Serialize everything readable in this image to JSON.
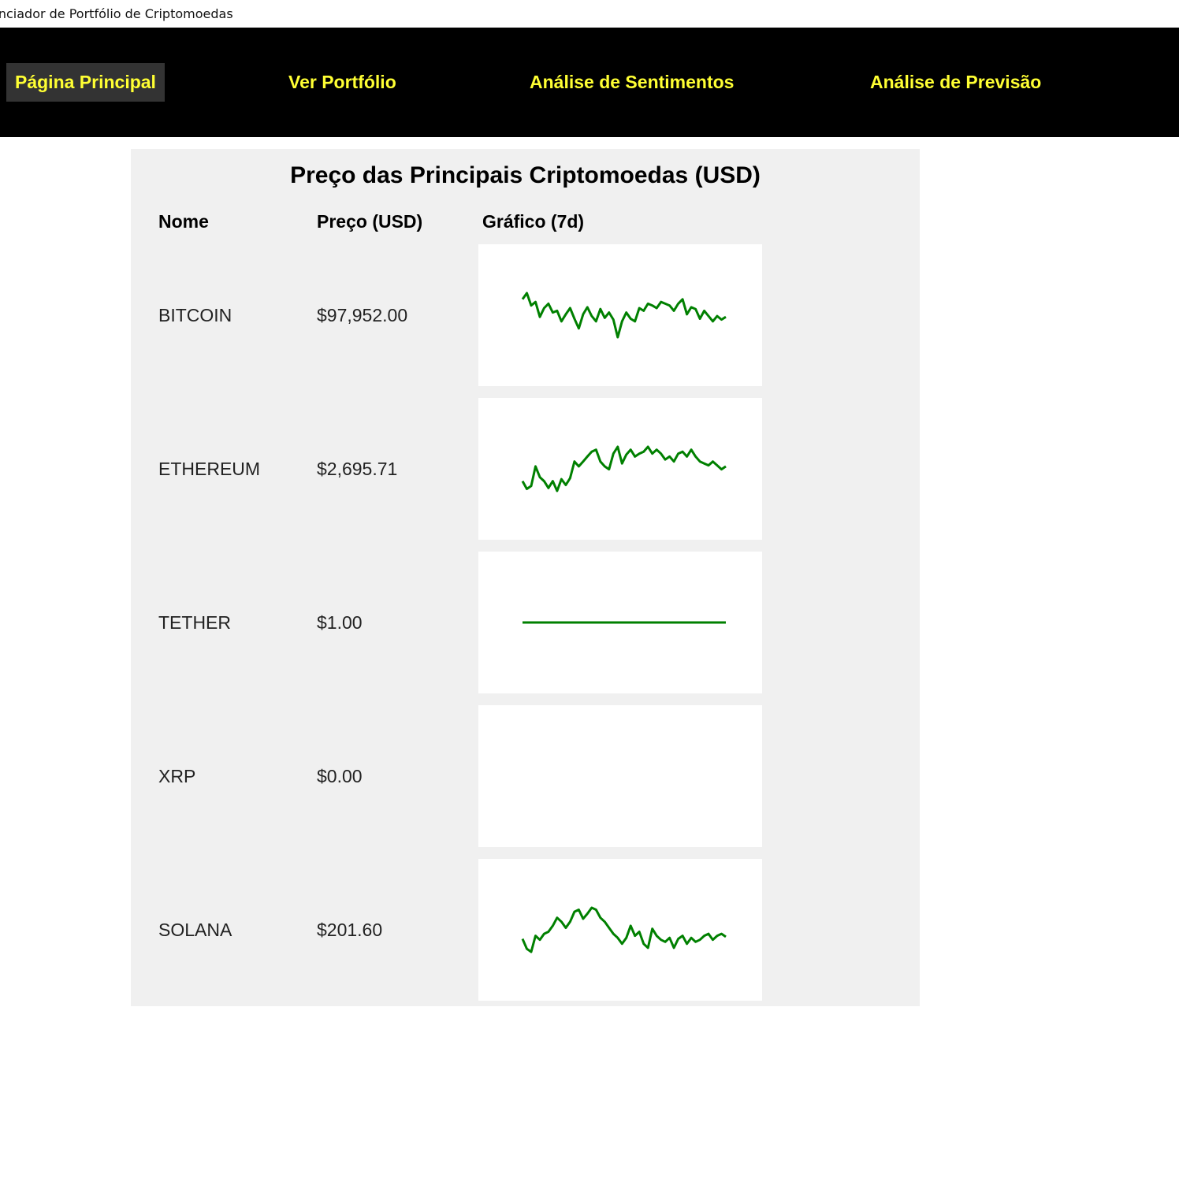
{
  "window": {
    "title": "enciador de Portfólio de Criptomoedas"
  },
  "nav": {
    "items": [
      {
        "label": "Página Principal",
        "active": true
      },
      {
        "label": "Ver Portfólio",
        "active": false
      },
      {
        "label": "Análise de Sentimentos",
        "active": false
      },
      {
        "label": "Análise de Previsão",
        "active": false
      }
    ]
  },
  "table": {
    "title": "Preço das Principais Criptomoedas (USD)",
    "headers": {
      "name": "Nome",
      "price": "Preço (USD)",
      "chart": "Gráfico (7d)"
    },
    "rows": [
      {
        "name": "BITCOIN",
        "price": "$97,952.00"
      },
      {
        "name": "ETHEREUM",
        "price": "$2,695.71"
      },
      {
        "name": "TETHER",
        "price": "$1.00"
      },
      {
        "name": "XRP",
        "price": "$0.00"
      },
      {
        "name": "SOLANA",
        "price": "$201.60"
      }
    ]
  },
  "colors": {
    "navbar_bg": "#000000",
    "nav_text": "#ffff33",
    "nav_active_bg": "#333333",
    "panel_bg": "#f0f0f0",
    "sparkline": "#008000"
  },
  "chart_data": [
    {
      "type": "line",
      "series": [
        {
          "values": [
            0.55,
            0.62,
            0.48,
            0.52,
            0.35,
            0.45,
            0.5,
            0.4,
            0.42,
            0.3,
            0.38,
            0.45,
            0.33,
            0.22,
            0.38,
            0.46,
            0.36,
            0.3,
            0.44,
            0.34,
            0.4,
            0.32,
            0.12,
            0.3,
            0.4,
            0.33,
            0.3,
            0.45,
            0.42,
            0.5,
            0.48,
            0.45,
            0.52,
            0.5,
            0.48,
            0.42,
            0.5,
            0.55,
            0.38,
            0.46,
            0.44,
            0.33,
            0.42,
            0.36,
            0.3,
            0.36,
            0.32,
            0.35
          ]
        }
      ]
    },
    {
      "type": "line",
      "series": [
        {
          "values": [
            0.3,
            0.22,
            0.25,
            0.45,
            0.34,
            0.3,
            0.23,
            0.3,
            0.2,
            0.32,
            0.26,
            0.33,
            0.5,
            0.45,
            0.5,
            0.55,
            0.6,
            0.62,
            0.5,
            0.45,
            0.42,
            0.58,
            0.65,
            0.48,
            0.57,
            0.62,
            0.55,
            0.58,
            0.6,
            0.65,
            0.58,
            0.62,
            0.58,
            0.52,
            0.55,
            0.5,
            0.58,
            0.6,
            0.55,
            0.62,
            0.55,
            0.5,
            0.48,
            0.46,
            0.5,
            0.46,
            0.42,
            0.45
          ]
        }
      ]
    },
    {
      "type": "line",
      "series": [
        {
          "values": [
            1.0,
            1.0,
            1.0,
            1.0,
            1.0,
            1.0,
            1.0,
            1.0
          ]
        }
      ]
    },
    {
      "type": "line",
      "series": [
        {
          "values": []
        }
      ]
    },
    {
      "type": "line",
      "series": [
        {
          "values": [
            0.45,
            0.35,
            0.32,
            0.48,
            0.44,
            0.5,
            0.52,
            0.58,
            0.66,
            0.62,
            0.56,
            0.62,
            0.72,
            0.74,
            0.65,
            0.7,
            0.76,
            0.74,
            0.66,
            0.62,
            0.56,
            0.5,
            0.46,
            0.4,
            0.46,
            0.58,
            0.48,
            0.52,
            0.4,
            0.36,
            0.55,
            0.48,
            0.44,
            0.42,
            0.46,
            0.36,
            0.45,
            0.48,
            0.4,
            0.46,
            0.42,
            0.44,
            0.48,
            0.5,
            0.44,
            0.48,
            0.5,
            0.47
          ]
        }
      ]
    }
  ]
}
